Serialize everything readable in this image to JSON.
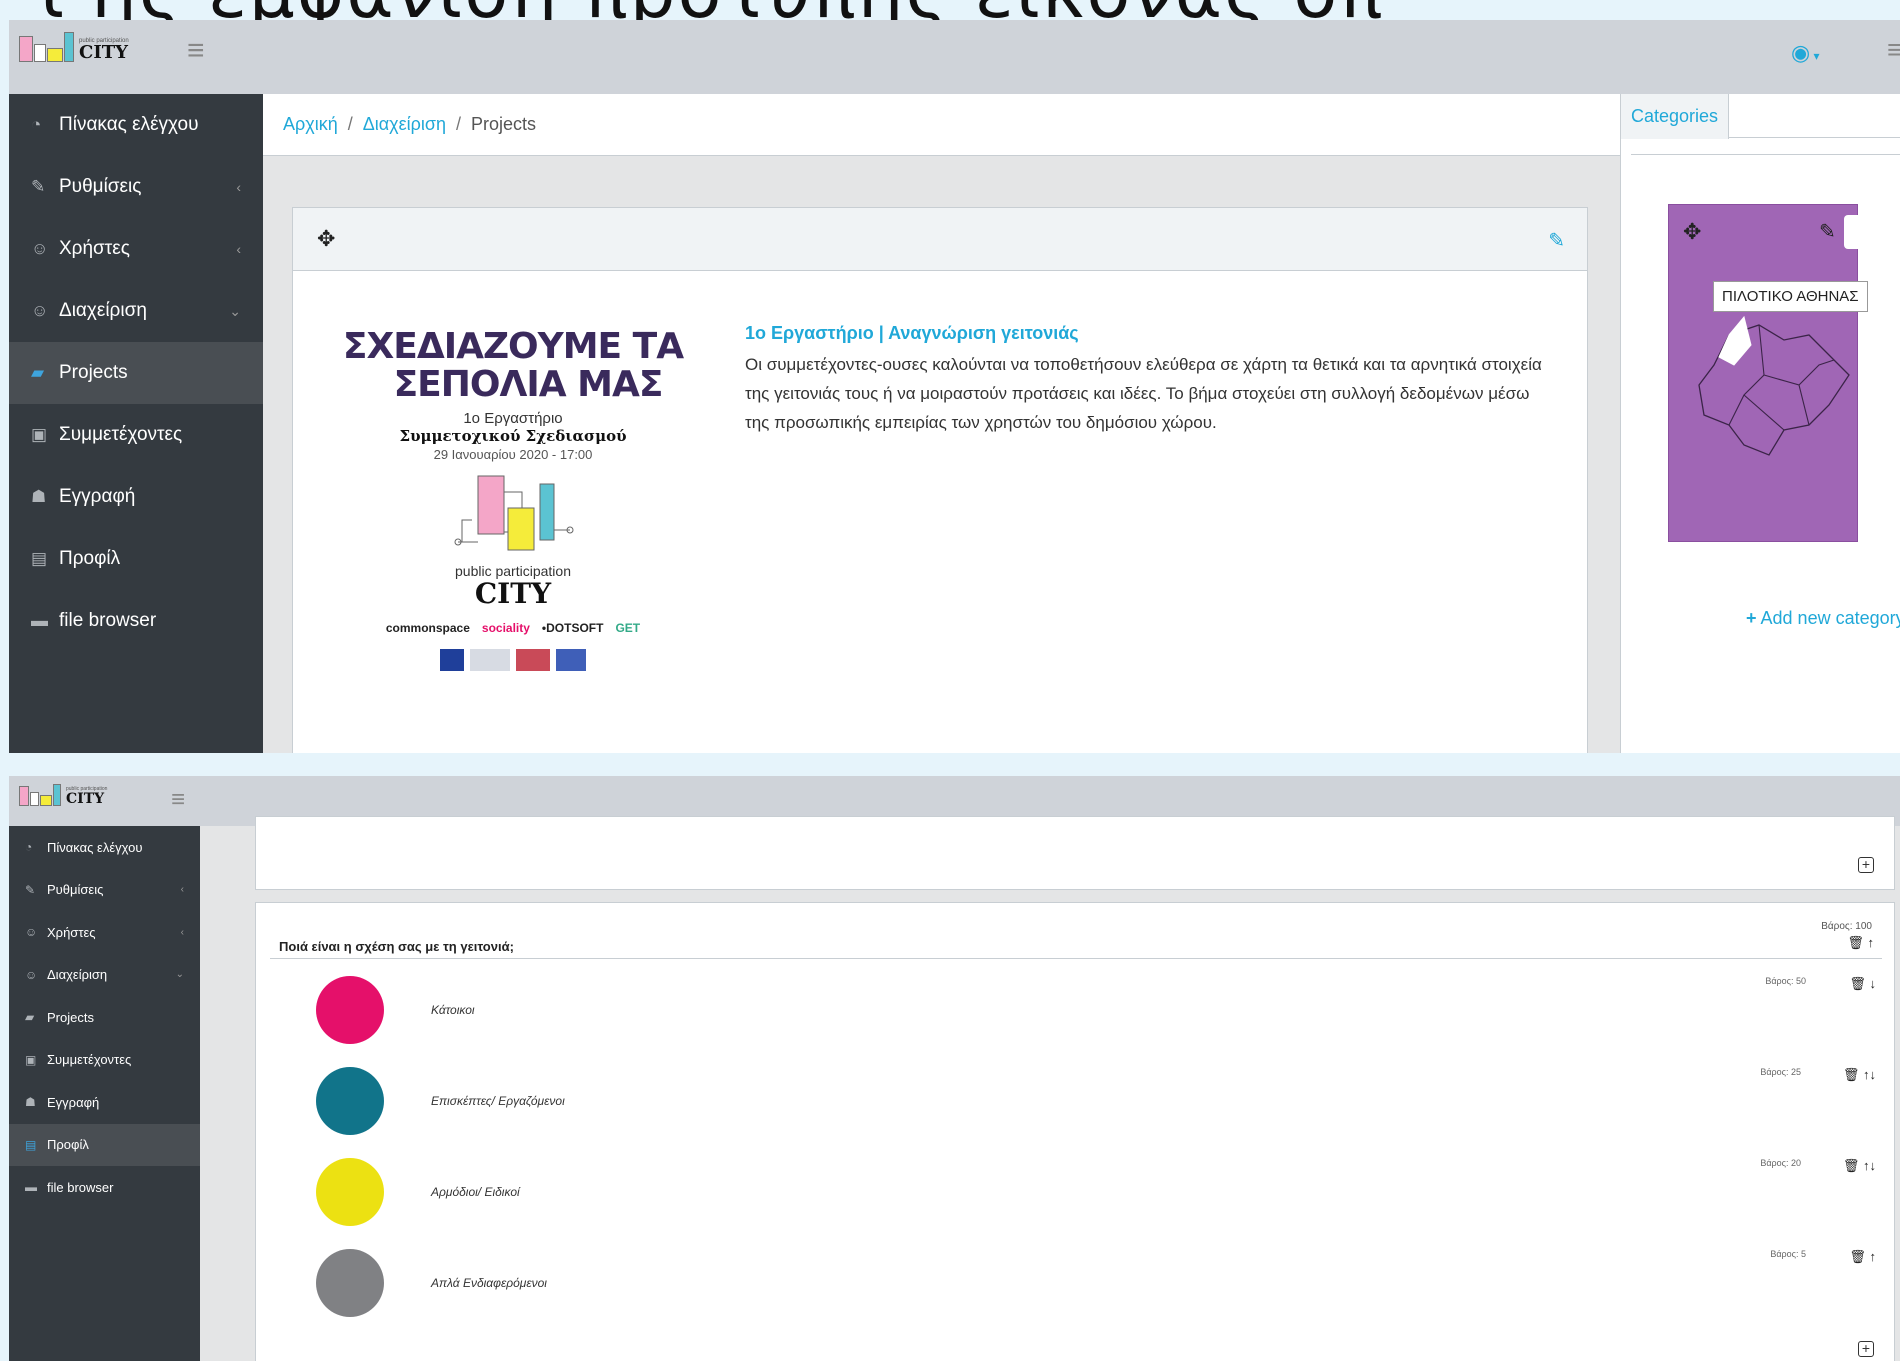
{
  "brand": {
    "small": "public participation",
    "name": "CITY"
  },
  "sidebar": {
    "items": [
      {
        "label": "Πίνακας ελέγχου",
        "icon": "speedometer-icon",
        "glyph": "◔",
        "chevron": ""
      },
      {
        "label": "Ρυθμίσεις",
        "icon": "wrench-icon",
        "glyph": "✎",
        "chevron": "‹"
      },
      {
        "label": "Χρήστες",
        "icon": "users-icon",
        "glyph": "☺",
        "chevron": "‹"
      },
      {
        "label": "Διαχείριση",
        "icon": "admin-icon",
        "glyph": "☺",
        "chevron": "⌄"
      },
      {
        "label": "Projects",
        "icon": "book-icon",
        "glyph": "▰",
        "chevron": ""
      },
      {
        "label": "Συμμετέχοντες",
        "icon": "contacts-icon",
        "glyph": "▣",
        "chevron": ""
      },
      {
        "label": "Εγγραφή",
        "icon": "user-plus-icon",
        "glyph": "☗",
        "chevron": ""
      },
      {
        "label": "Προφίλ",
        "icon": "id-card-icon",
        "glyph": "▤",
        "chevron": ""
      },
      {
        "label": "file browser",
        "icon": "folder-icon",
        "glyph": "▬",
        "chevron": ""
      }
    ]
  },
  "breadcrumb": {
    "home": "Αρχική",
    "section": "Διαχείριση",
    "current": "Projects"
  },
  "project": {
    "title": "1ο Εργαστήριο | Αναγνώριση γειτονιάς",
    "description": "Οι συμμετέχοντες-ουσες καλούνται να τοποθετήσουν ελεύθερα σε χάρτη τα θετικά και τα αρνητικά στοιχεία της γειτονιάς τους ή να μοιραστούν προτάσεις και ιδέες. Το βήμα στοχεύει στη συλλογή δεδομένων μέσω της προσωπικής εμπειρίας των χρηστών του δημόσιου χώρου.",
    "poster": {
      "line1": "ΣΧΕΔΙΑΖΟΥΜΕ ΤΑ",
      "line2": "ΣΕΠΟΛΙΑ ΜΑΣ",
      "subtitle1": "1ο Εργαστήριο",
      "subtitle2": "Συμμετοχικού Σχεδιασμού",
      "date": "29 Ιανουαρίου 2020 - 17:00",
      "pp": "public participation",
      "city": "CITY",
      "sponsors": [
        "commonspace",
        "sociality",
        "•DOTSOFT",
        "GET"
      ]
    }
  },
  "aside": {
    "tab": "Categories",
    "map_label": "ΠΙΛΟΤΙΚΟ ΑΘΗΝΑΣ",
    "add_category": "Add new category",
    "card_color": "#a066b5"
  },
  "question": {
    "title": "Ποιά είναι η σχέση σας με τη γειτονιά;",
    "weight": "Βάρος: 100",
    "options": [
      {
        "label": "Κάτοικοι",
        "weight": "Βάρος: 50",
        "color": "#e5106a",
        "arrows": "↓"
      },
      {
        "label": "Επισκέπτες/ Εργαζόμενοι",
        "weight": "Βάρος: 25",
        "color": "#11748a",
        "arrows": "↑↓"
      },
      {
        "label": "Αρμόδιοι/ Ειδικοί",
        "weight": "Βάρος: 20",
        "color": "#ece112",
        "arrows": "↑↓"
      },
      {
        "label": "Απλά Ενδιαφερόμενοι",
        "weight": "Βάρος: 5",
        "color": "#808184",
        "arrows": "↑"
      }
    ]
  },
  "colors": {
    "accent": "#20a8d8",
    "sidebar": "#343a40",
    "topbar": "#cfd3d9"
  }
}
